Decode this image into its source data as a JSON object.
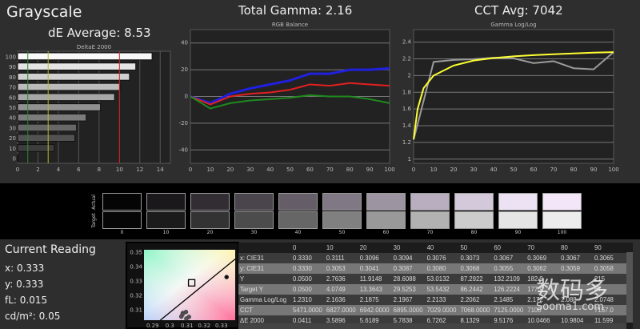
{
  "header": {
    "title": "Grayscale",
    "de_average": "dE Average: 8.53",
    "total_gamma": "Total Gamma: 2.16",
    "cct_avg": "CCT Avg: 7042"
  },
  "colors": {
    "background": "#2e2e2e",
    "plot": "#222222",
    "red": "#e02020",
    "green": "#1e8a1e",
    "blue": "#2020e0",
    "target": "#ffff33",
    "measured": "#9a9a9a"
  },
  "chart_data": [
    {
      "type": "bar",
      "title": "DeltaE 2000",
      "orientation": "horizontal",
      "categories": [
        "0",
        "10",
        "20",
        "30",
        "40",
        "50",
        "60",
        "70",
        "80",
        "90",
        "100"
      ],
      "values": [
        0.0411,
        3.5896,
        5.6189,
        5.7838,
        6.7262,
        8.1329,
        9.5176,
        10.0466,
        10.9804,
        11.599,
        13.2
      ],
      "xlim": [
        0,
        15
      ],
      "xticks": [
        "0",
        "2",
        "4",
        "6",
        "8",
        "10",
        "12",
        "14"
      ],
      "reference_lines": [
        {
          "x": 1,
          "color": "#2a8a2a"
        },
        {
          "x": 3,
          "color": "#b8b830"
        },
        {
          "x": 10,
          "color": "#d02020"
        }
      ],
      "grid": true
    },
    {
      "type": "line",
      "title": "RGB Balance",
      "x": [
        0,
        10,
        20,
        30,
        40,
        50,
        60,
        70,
        80,
        90,
        100
      ],
      "series": [
        {
          "color": "#2020e0",
          "values": [
            0,
            -5,
            2,
            6,
            9,
            12,
            17,
            17,
            20,
            20,
            21
          ]
        },
        {
          "color": "#e02020",
          "values": [
            0,
            -6,
            0,
            2,
            3,
            5,
            9,
            8,
            10,
            9,
            8
          ]
        },
        {
          "color": "#1e8a1e",
          "values": [
            0,
            -9,
            -5,
            -3,
            -2,
            -1,
            1,
            0,
            0,
            -2,
            -5
          ]
        }
      ],
      "ylim": [
        -50,
        50
      ],
      "yticks": [
        "40",
        "20",
        "0",
        "-20",
        "-40"
      ],
      "xticks": [
        "0",
        "10",
        "20",
        "30",
        "40",
        "50",
        "60",
        "70",
        "80",
        "90",
        "100"
      ],
      "grid": true
    },
    {
      "type": "line",
      "title": "Gamma Log/Log",
      "series": [
        {
          "color": "#9a9a9a",
          "x": [
            0,
            10,
            20,
            30,
            40,
            50,
            60,
            70,
            80,
            90,
            100
          ],
          "values": [
            1.231,
            2.1636,
            2.1875,
            2.1967,
            2.2133,
            2.2062,
            2.1485,
            2.172,
            2.088,
            2.0748,
            2.28
          ]
        },
        {
          "color": "#ffff33",
          "x": [
            0,
            2,
            5,
            10,
            20,
            30,
            40,
            50,
            60,
            70,
            80,
            90,
            100
          ],
          "values": [
            1.24,
            1.6,
            1.85,
            2.0,
            2.12,
            2.18,
            2.21,
            2.23,
            2.245,
            2.255,
            2.265,
            2.275,
            2.28
          ]
        }
      ],
      "ylim": [
        0.95,
        2.55
      ],
      "yticks": [
        "2.4",
        "2.2",
        "2",
        "1.8",
        "1.6",
        "1.4",
        "1.2",
        "1"
      ],
      "xticks": [
        "0",
        "10",
        "20",
        "30",
        "40",
        "50",
        "60",
        "70",
        "80",
        "90",
        "100"
      ],
      "grid": true
    },
    {
      "type": "scatter",
      "title": "",
      "xlim": [
        0.285,
        0.338
      ],
      "ylim": [
        0.303,
        0.352
      ],
      "xticks": [
        "0.29",
        "0.3",
        "0.31",
        "0.32",
        "0.33"
      ],
      "yticks": [
        "0.35",
        "0.34",
        "0.33",
        "0.32",
        "0.31"
      ],
      "target": {
        "x": 0.3127,
        "y": 0.329
      },
      "points": [
        {
          "x": 0.333,
          "y": 0.333
        },
        {
          "x": 0.3111,
          "y": 0.3053
        },
        {
          "x": 0.3096,
          "y": 0.3041
        },
        {
          "x": 0.3094,
          "y": 0.3087
        },
        {
          "x": 0.3076,
          "y": 0.308
        },
        {
          "x": 0.3073,
          "y": 0.3068
        },
        {
          "x": 0.3067,
          "y": 0.3055
        }
      ]
    }
  ],
  "swatches": {
    "row_labels": [
      "Actual",
      "Target"
    ],
    "labels": [
      "0",
      "10",
      "20",
      "30",
      "40",
      "50",
      "60",
      "70",
      "80",
      "90",
      "100"
    ],
    "actual": [
      "#050505",
      "#1a181b",
      "#322d33",
      "#4a444c",
      "#655e68",
      "#807884",
      "#9d94a1",
      "#b9aebf",
      "#d4c9db",
      "#ece2f3",
      "#f2e6f8"
    ],
    "target": [
      "#060606",
      "#1b1b1b",
      "#333333",
      "#4c4c4c",
      "#666666",
      "#808080",
      "#999999",
      "#b2b2b2",
      "#cccccc",
      "#e5e5e5",
      "#ececec"
    ]
  },
  "reading": {
    "title": "Current Reading",
    "x": "x: 0.333",
    "y": "y: 0.333",
    "fl": "fL: 0.015",
    "cdm2": "cd/m²: 0.05"
  },
  "table": {
    "columns": [
      "",
      "0",
      "10",
      "20",
      "30",
      "40",
      "50",
      "60",
      "70",
      "80",
      "90"
    ],
    "rows": [
      [
        "x: CIE31",
        "0.3330",
        "0.3111",
        "0.3096",
        "0.3094",
        "0.3076",
        "0.3073",
        "0.3067",
        "0.3069",
        "0.3067",
        "0.3065"
      ],
      [
        "y: CIE31",
        "0.3330",
        "0.3053",
        "0.3041",
        "0.3087",
        "0.3080",
        "0.3068",
        "0.3055",
        "0.3062",
        "0.3059",
        "0.3058"
      ],
      [
        "Y",
        "0.0500",
        "2.7636",
        "11.9148",
        "28.6088",
        "53.0132",
        "87.2922",
        "132.2109",
        "182.9",
        "",
        "215"
      ],
      [
        "Target Y",
        "0.0500",
        "4.0749",
        "13.3643",
        "29.5253",
        "53.5432",
        "86.2442",
        "126.2224",
        "177.9",
        "",
        "67"
      ],
      [
        "Gamma Log/Log",
        "1.2310",
        "2.1636",
        "2.1875",
        "2.1967",
        "2.2133",
        "2.2062",
        "2.1485",
        "2.172",
        "2.088",
        "2.0748"
      ],
      [
        "CCT",
        "5471.0000",
        "6827.0000",
        "6942.0000",
        "6895.0000",
        "7029.0000",
        "7068.0000",
        "7125.0000",
        "7100",
        "",
        "7167.0"
      ],
      [
        "ΔE 2000",
        "0.0411",
        "3.5896",
        "5.6189",
        "5.7838",
        "6.7262",
        "8.1329",
        "9.5176",
        "10.0466",
        "10.9804",
        "11.599"
      ]
    ]
  },
  "watermark": {
    "cn": "数码多",
    "url": "Sooma1.com"
  }
}
